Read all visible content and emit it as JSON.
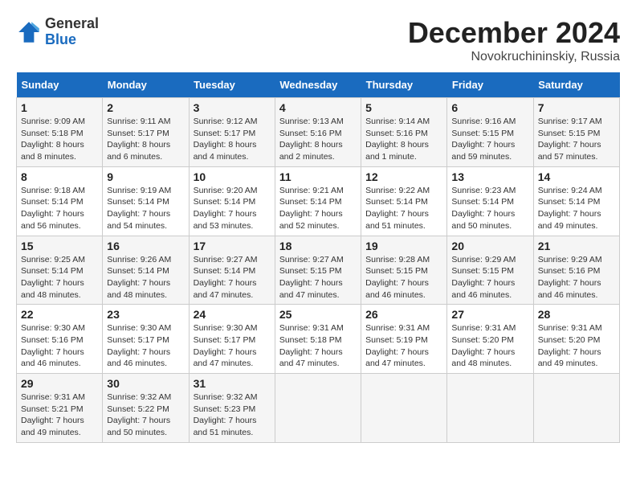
{
  "header": {
    "logo_line1": "General",
    "logo_line2": "Blue",
    "month_title": "December 2024",
    "location": "Novokruchininskiy, Russia"
  },
  "weekdays": [
    "Sunday",
    "Monday",
    "Tuesday",
    "Wednesday",
    "Thursday",
    "Friday",
    "Saturday"
  ],
  "weeks": [
    [
      {
        "day": "1",
        "sunrise": "Sunrise: 9:09 AM",
        "sunset": "Sunset: 5:18 PM",
        "daylight": "Daylight: 8 hours and 8 minutes."
      },
      {
        "day": "2",
        "sunrise": "Sunrise: 9:11 AM",
        "sunset": "Sunset: 5:17 PM",
        "daylight": "Daylight: 8 hours and 6 minutes."
      },
      {
        "day": "3",
        "sunrise": "Sunrise: 9:12 AM",
        "sunset": "Sunset: 5:17 PM",
        "daylight": "Daylight: 8 hours and 4 minutes."
      },
      {
        "day": "4",
        "sunrise": "Sunrise: 9:13 AM",
        "sunset": "Sunset: 5:16 PM",
        "daylight": "Daylight: 8 hours and 2 minutes."
      },
      {
        "day": "5",
        "sunrise": "Sunrise: 9:14 AM",
        "sunset": "Sunset: 5:16 PM",
        "daylight": "Daylight: 8 hours and 1 minute."
      },
      {
        "day": "6",
        "sunrise": "Sunrise: 9:16 AM",
        "sunset": "Sunset: 5:15 PM",
        "daylight": "Daylight: 7 hours and 59 minutes."
      },
      {
        "day": "7",
        "sunrise": "Sunrise: 9:17 AM",
        "sunset": "Sunset: 5:15 PM",
        "daylight": "Daylight: 7 hours and 57 minutes."
      }
    ],
    [
      {
        "day": "8",
        "sunrise": "Sunrise: 9:18 AM",
        "sunset": "Sunset: 5:14 PM",
        "daylight": "Daylight: 7 hours and 56 minutes."
      },
      {
        "day": "9",
        "sunrise": "Sunrise: 9:19 AM",
        "sunset": "Sunset: 5:14 PM",
        "daylight": "Daylight: 7 hours and 54 minutes."
      },
      {
        "day": "10",
        "sunrise": "Sunrise: 9:20 AM",
        "sunset": "Sunset: 5:14 PM",
        "daylight": "Daylight: 7 hours and 53 minutes."
      },
      {
        "day": "11",
        "sunrise": "Sunrise: 9:21 AM",
        "sunset": "Sunset: 5:14 PM",
        "daylight": "Daylight: 7 hours and 52 minutes."
      },
      {
        "day": "12",
        "sunrise": "Sunrise: 9:22 AM",
        "sunset": "Sunset: 5:14 PM",
        "daylight": "Daylight: 7 hours and 51 minutes."
      },
      {
        "day": "13",
        "sunrise": "Sunrise: 9:23 AM",
        "sunset": "Sunset: 5:14 PM",
        "daylight": "Daylight: 7 hours and 50 minutes."
      },
      {
        "day": "14",
        "sunrise": "Sunrise: 9:24 AM",
        "sunset": "Sunset: 5:14 PM",
        "daylight": "Daylight: 7 hours and 49 minutes."
      }
    ],
    [
      {
        "day": "15",
        "sunrise": "Sunrise: 9:25 AM",
        "sunset": "Sunset: 5:14 PM",
        "daylight": "Daylight: 7 hours and 48 minutes."
      },
      {
        "day": "16",
        "sunrise": "Sunrise: 9:26 AM",
        "sunset": "Sunset: 5:14 PM",
        "daylight": "Daylight: 7 hours and 48 minutes."
      },
      {
        "day": "17",
        "sunrise": "Sunrise: 9:27 AM",
        "sunset": "Sunset: 5:14 PM",
        "daylight": "Daylight: 7 hours and 47 minutes."
      },
      {
        "day": "18",
        "sunrise": "Sunrise: 9:27 AM",
        "sunset": "Sunset: 5:15 PM",
        "daylight": "Daylight: 7 hours and 47 minutes."
      },
      {
        "day": "19",
        "sunrise": "Sunrise: 9:28 AM",
        "sunset": "Sunset: 5:15 PM",
        "daylight": "Daylight: 7 hours and 46 minutes."
      },
      {
        "day": "20",
        "sunrise": "Sunrise: 9:29 AM",
        "sunset": "Sunset: 5:15 PM",
        "daylight": "Daylight: 7 hours and 46 minutes."
      },
      {
        "day": "21",
        "sunrise": "Sunrise: 9:29 AM",
        "sunset": "Sunset: 5:16 PM",
        "daylight": "Daylight: 7 hours and 46 minutes."
      }
    ],
    [
      {
        "day": "22",
        "sunrise": "Sunrise: 9:30 AM",
        "sunset": "Sunset: 5:16 PM",
        "daylight": "Daylight: 7 hours and 46 minutes."
      },
      {
        "day": "23",
        "sunrise": "Sunrise: 9:30 AM",
        "sunset": "Sunset: 5:17 PM",
        "daylight": "Daylight: 7 hours and 46 minutes."
      },
      {
        "day": "24",
        "sunrise": "Sunrise: 9:30 AM",
        "sunset": "Sunset: 5:17 PM",
        "daylight": "Daylight: 7 hours and 47 minutes."
      },
      {
        "day": "25",
        "sunrise": "Sunrise: 9:31 AM",
        "sunset": "Sunset: 5:18 PM",
        "daylight": "Daylight: 7 hours and 47 minutes."
      },
      {
        "day": "26",
        "sunrise": "Sunrise: 9:31 AM",
        "sunset": "Sunset: 5:19 PM",
        "daylight": "Daylight: 7 hours and 47 minutes."
      },
      {
        "day": "27",
        "sunrise": "Sunrise: 9:31 AM",
        "sunset": "Sunset: 5:20 PM",
        "daylight": "Daylight: 7 hours and 48 minutes."
      },
      {
        "day": "28",
        "sunrise": "Sunrise: 9:31 AM",
        "sunset": "Sunset: 5:20 PM",
        "daylight": "Daylight: 7 hours and 49 minutes."
      }
    ],
    [
      {
        "day": "29",
        "sunrise": "Sunrise: 9:31 AM",
        "sunset": "Sunset: 5:21 PM",
        "daylight": "Daylight: 7 hours and 49 minutes."
      },
      {
        "day": "30",
        "sunrise": "Sunrise: 9:32 AM",
        "sunset": "Sunset: 5:22 PM",
        "daylight": "Daylight: 7 hours and 50 minutes."
      },
      {
        "day": "31",
        "sunrise": "Sunrise: 9:32 AM",
        "sunset": "Sunset: 5:23 PM",
        "daylight": "Daylight: 7 hours and 51 minutes."
      },
      null,
      null,
      null,
      null
    ]
  ]
}
